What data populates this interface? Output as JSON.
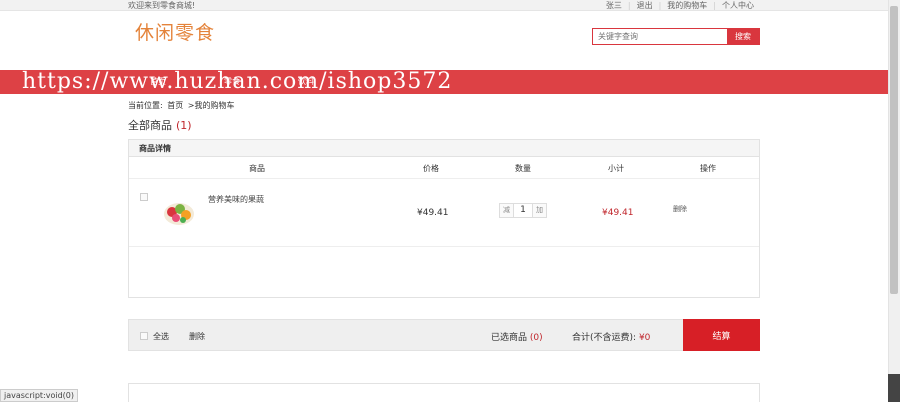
{
  "topbar": {
    "welcome": "欢迎来到零食商城!",
    "user": "张三",
    "logout": "退出",
    "cart": "我的购物车",
    "center": "个人中心"
  },
  "header": {
    "logo": "休闲零食",
    "search_placeholder": "关键字查询",
    "search_button": "搜索"
  },
  "nav": {
    "items": [
      "首页",
      "零食",
      "饮料"
    ]
  },
  "watermark": "https://www.huzhan.com/ishop3572",
  "breadcrumb": {
    "prefix": "当前位置:",
    "home": "首页",
    "current": ">我的购物车"
  },
  "title": {
    "label": "全部商品",
    "count": "(1)"
  },
  "cart": {
    "section_label": "商品详情",
    "columns": [
      "商品",
      "价格",
      "数量",
      "小计",
      "操作"
    ],
    "items": [
      {
        "name": "营养美味的果蔬",
        "price": "¥49.41",
        "qty": "1",
        "minus": "减",
        "plus": "加",
        "subtotal": "¥49.41",
        "delete": "删除"
      }
    ]
  },
  "footer": {
    "select_all": "全选",
    "delete": "删除",
    "selected_label": "已选商品",
    "selected_count": "(0)",
    "total_label": "合计(不含运费):",
    "total_value": "¥0",
    "checkout": "结算"
  },
  "status": "javascript:void(0)",
  "colors": {
    "brand_red": "#dd4145",
    "price_red": "#c0262c",
    "logo_orange": "#e4833a"
  }
}
